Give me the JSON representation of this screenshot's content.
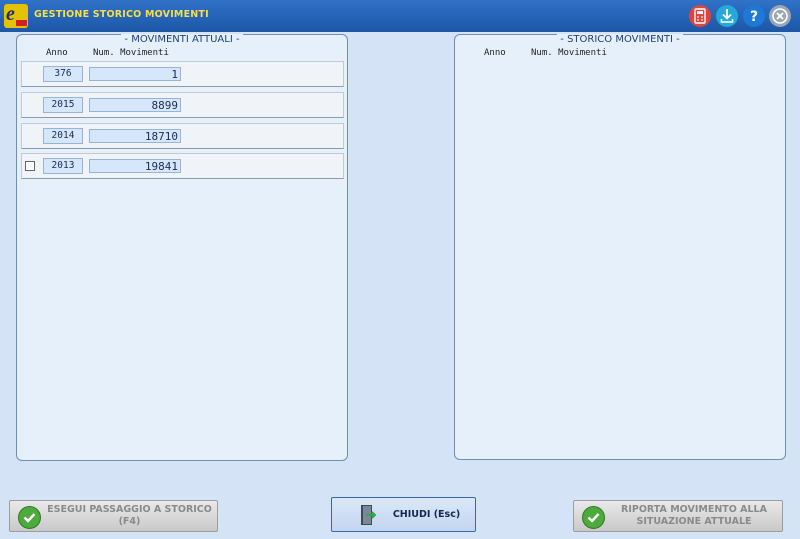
{
  "window": {
    "title": "GESTIONE STORICO MOVIMENTI"
  },
  "titlebar_icons": [
    "calculator-icon",
    "download-icon",
    "help-icon",
    "close-icon"
  ],
  "left_panel": {
    "title": "- MOVIMENTI ATTUALI -",
    "col_anno": "Anno",
    "col_num": "Num. Movimenti",
    "rows": [
      {
        "anno": "376",
        "num": "1",
        "checkbox": false
      },
      {
        "anno": "2015",
        "num": "8899",
        "checkbox": false
      },
      {
        "anno": "2014",
        "num": "18710",
        "checkbox": false
      },
      {
        "anno": "2013",
        "num": "19841",
        "checkbox": true
      }
    ]
  },
  "right_panel": {
    "title": "- STORICO MOVIMENTI -",
    "col_anno": "Anno",
    "col_num": "Num. Movimenti"
  },
  "buttons": {
    "esegui": "ESEGUI PASSAGGIO A STORICO (F4)",
    "chiudi": "CHIUDI  (Esc)",
    "riporta_line1": "RIPORTA MOVIMENTO ALLA",
    "riporta_line2": "SITUAZIONE ATTUALE"
  },
  "colors": {
    "titlebar": "#1d57a6",
    "title_text": "#f4e04a",
    "background": "#d4e3f5",
    "panel": "#e6f0fb"
  }
}
